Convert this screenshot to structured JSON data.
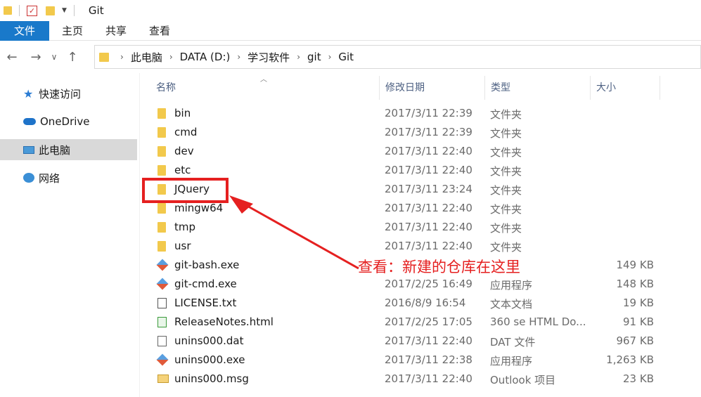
{
  "title_bar": {
    "title": "Git"
  },
  "ribbon": {
    "tabs": [
      "文件",
      "主页",
      "共享",
      "查看"
    ]
  },
  "address": {
    "crumbs": [
      "此电脑",
      "DATA (D:)",
      "学习软件",
      "git",
      "Git"
    ]
  },
  "sidebar": {
    "items": [
      {
        "label": "快速访问",
        "icon": "star-icon"
      },
      {
        "label": "OneDrive",
        "icon": "cloud-icon"
      },
      {
        "label": "此电脑",
        "icon": "computer-icon"
      },
      {
        "label": "网络",
        "icon": "network-icon"
      }
    ]
  },
  "columns": {
    "name": "名称",
    "date": "修改日期",
    "type": "类型",
    "size": "大小"
  },
  "files": [
    {
      "name": "bin",
      "date": "2017/3/11 22:39",
      "type": "文件夹",
      "size": "",
      "icon": "folder"
    },
    {
      "name": "cmd",
      "date": "2017/3/11 22:39",
      "type": "文件夹",
      "size": "",
      "icon": "folder"
    },
    {
      "name": "dev",
      "date": "2017/3/11 22:40",
      "type": "文件夹",
      "size": "",
      "icon": "folder"
    },
    {
      "name": "etc",
      "date": "2017/3/11 22:40",
      "type": "文件夹",
      "size": "",
      "icon": "folder"
    },
    {
      "name": "JQuery",
      "date": "2017/3/11 23:24",
      "type": "文件夹",
      "size": "",
      "icon": "folder"
    },
    {
      "name": "mingw64",
      "date": "2017/3/11 22:40",
      "type": "文件夹",
      "size": "",
      "icon": "folder"
    },
    {
      "name": "tmp",
      "date": "2017/3/11 22:40",
      "type": "文件夹",
      "size": "",
      "icon": "folder"
    },
    {
      "name": "usr",
      "date": "2017/3/11 22:40",
      "type": "文件夹",
      "size": "",
      "icon": "folder"
    },
    {
      "name": "git-bash.exe",
      "date": "",
      "type": "",
      "size": "149 KB",
      "icon": "exe"
    },
    {
      "name": "git-cmd.exe",
      "date": "2017/2/25 16:49",
      "type": "应用程序",
      "size": "148 KB",
      "icon": "exe"
    },
    {
      "name": "LICENSE.txt",
      "date": "2016/8/9 16:54",
      "type": "文本文档",
      "size": "19 KB",
      "icon": "txt"
    },
    {
      "name": "ReleaseNotes.html",
      "date": "2017/2/25 17:05",
      "type": "360 se HTML Do...",
      "size": "91 KB",
      "icon": "html"
    },
    {
      "name": "unins000.dat",
      "date": "2017/3/11 22:40",
      "type": "DAT 文件",
      "size": "967 KB",
      "icon": "dat"
    },
    {
      "name": "unins000.exe",
      "date": "2017/3/11 22:38",
      "type": "应用程序",
      "size": "1,263 KB",
      "icon": "exe"
    },
    {
      "name": "unins000.msg",
      "date": "2017/3/11 22:40",
      "type": "Outlook 项目",
      "size": "23 KB",
      "icon": "msg"
    }
  ],
  "annotation": {
    "text": "查看：新建的仓库在这里",
    "color": "#e52020"
  }
}
